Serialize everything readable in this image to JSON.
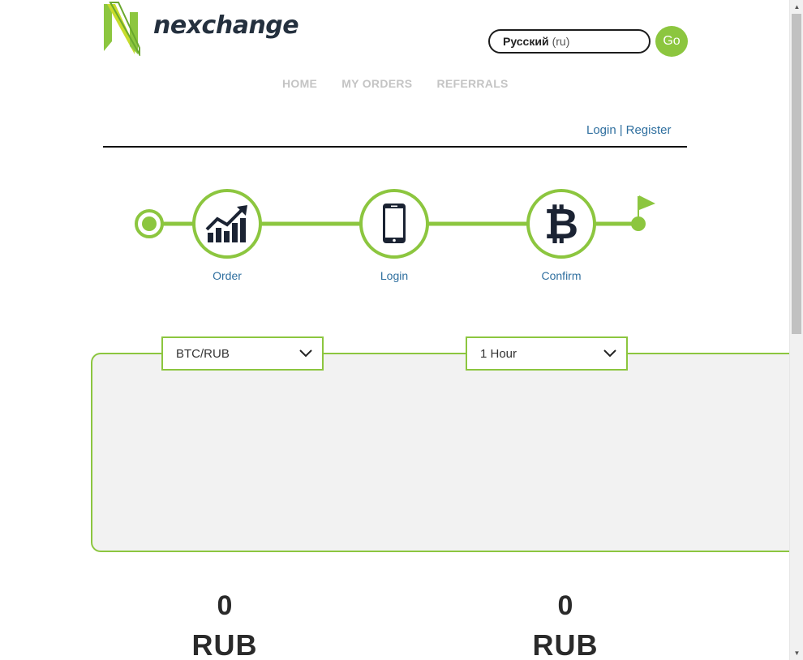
{
  "brand": {
    "name": "nexchange"
  },
  "language": {
    "name": "Русский",
    "code": "(ru)",
    "go_label": "Go"
  },
  "nav": {
    "items": [
      {
        "label": "HOME"
      },
      {
        "label": "MY ORDERS"
      },
      {
        "label": "REFERRALS"
      }
    ]
  },
  "auth": {
    "login": "Login",
    "separator": "|",
    "register": "Register"
  },
  "steps": {
    "items": [
      {
        "label": "Order",
        "icon": "chart-up-icon"
      },
      {
        "label": "Login",
        "icon": "phone-icon"
      },
      {
        "label": "Confirm",
        "icon": "bitcoin-icon"
      }
    ]
  },
  "chart_controls": {
    "pair": "BTC/RUB",
    "period": "1 Hour"
  },
  "amounts": [
    {
      "value": "0",
      "currency": "RUB"
    },
    {
      "value": "0",
      "currency": "RUB"
    }
  ],
  "colors": {
    "accent": "#8cc63f",
    "link": "#2f6f9f",
    "nav_muted": "#c4c4c4",
    "brand_dark": "#24303e"
  }
}
